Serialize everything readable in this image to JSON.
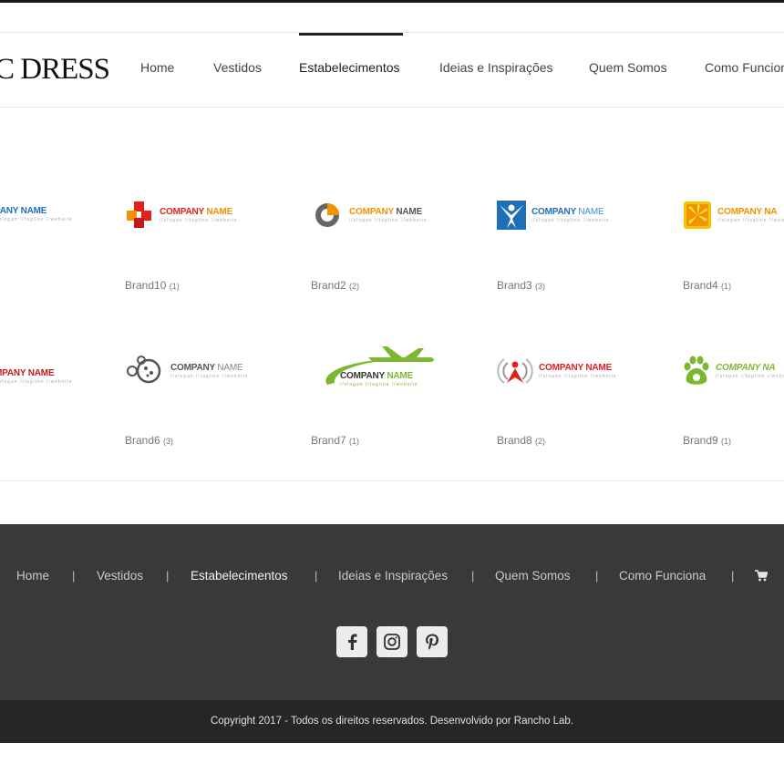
{
  "header": {
    "logo_text": "C DRESS",
    "nav": [
      {
        "label": "Home"
      },
      {
        "label": "Vestidos"
      },
      {
        "label": "Estabelecimentos"
      },
      {
        "label": "Ideias e Inspirações"
      },
      {
        "label": "Quem Somos"
      },
      {
        "label": "Como Funcion"
      }
    ],
    "active_nav": "Estabelecimentos"
  },
  "brands": {
    "logo_name_left": "COMPANY",
    "logo_name_right": "NAME",
    "logo_tagline": "//slogan   //tagline   //website",
    "items": [
      {
        "name": "Brand10",
        "count": "(1)"
      },
      {
        "name": "Brand2",
        "count": "(2)"
      },
      {
        "name": "Brand3",
        "count": "(3)"
      },
      {
        "name": "Brand4",
        "count": "(1)"
      },
      {
        "name": "Brand6",
        "count": "(3)"
      },
      {
        "name": "Brand7",
        "count": "(1)"
      },
      {
        "name": "Brand8",
        "count": "(2)"
      },
      {
        "name": "Brand9",
        "count": "(1)"
      }
    ],
    "partial_left_row1": "PANY NAME",
    "partial_left_row2": "MPANY NAME",
    "partial_right_row1": "COMPANY NA",
    "partial_right_row2": "COMPANY NA"
  },
  "footer": {
    "nav": [
      {
        "label": "Home"
      },
      {
        "label": "Vestidos"
      },
      {
        "label": "Estabelecimentos"
      },
      {
        "label": "Ideias e Inspirações"
      },
      {
        "label": "Quem Somos"
      },
      {
        "label": "Como Funciona"
      }
    ],
    "separator": "|",
    "social": [
      "facebook-icon",
      "instagram-icon",
      "pinterest-icon"
    ],
    "copyright": "Copyright 2017 - Todos os direitos reservados. Desenvolvido por Rancho Lab."
  },
  "colors": {
    "footer_bg": "#38393b",
    "copy_bg": "#262627",
    "orange": "#f39200",
    "red": "#e2211c",
    "blue": "#1d6fb8",
    "green": "#7cb82f"
  }
}
